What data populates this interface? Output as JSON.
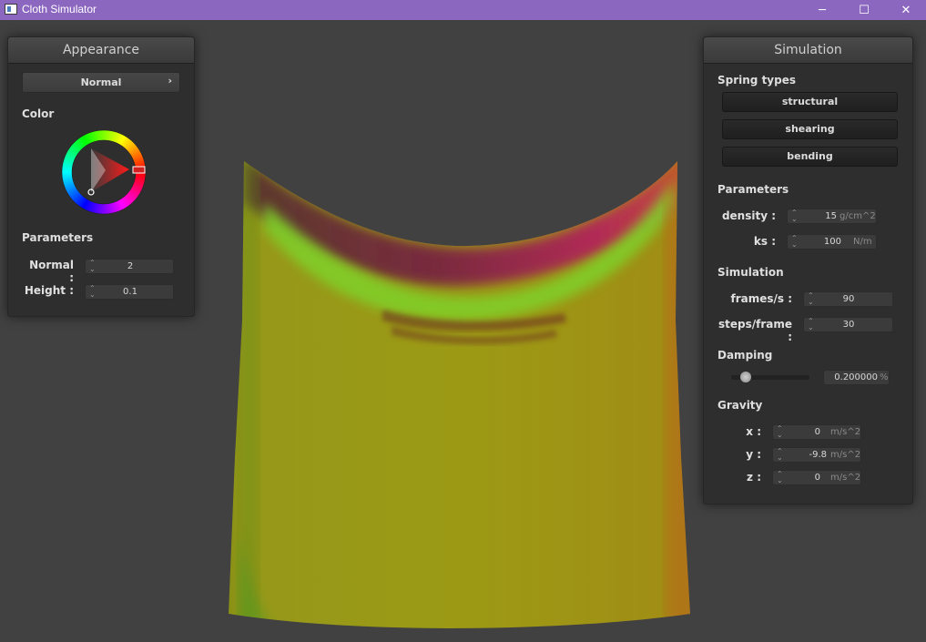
{
  "window": {
    "title": "Cloth Simulator",
    "minimize_glyph": "─",
    "maximize_glyph": "☐",
    "close_glyph": "✕"
  },
  "appearance": {
    "title": "Appearance",
    "shader_dropdown": {
      "selected": "Normal",
      "chevron": "›"
    },
    "color_label": "Color",
    "parameters_label": "Parameters",
    "params": [
      {
        "label": "Normal :",
        "value": "2"
      },
      {
        "label": "Height :",
        "value": "0.1"
      }
    ]
  },
  "simulation": {
    "title": "Simulation",
    "spring_types_label": "Spring types",
    "spring_buttons": [
      "structural",
      "shearing",
      "bending"
    ],
    "parameters_label": "Parameters",
    "density": {
      "label": "density :",
      "value": "15",
      "unit": "g/cm^2"
    },
    "ks": {
      "label": "ks :",
      "value": "100",
      "unit": "N/m"
    },
    "simulation_label": "Simulation",
    "frames": {
      "label": "frames/s :",
      "value": "90"
    },
    "steps": {
      "label": "steps/frame :",
      "value": "30"
    },
    "damping_label": "Damping",
    "damping": {
      "value": "0.200000",
      "unit": "%",
      "slider_fraction": 0.2
    },
    "gravity_label": "Gravity",
    "gravity": [
      {
        "label": "x :",
        "value": "0",
        "unit": "m/s^2"
      },
      {
        "label": "y :",
        "value": "-9.8",
        "unit": "m/s^2"
      },
      {
        "label": "z :",
        "value": "0",
        "unit": "m/s^2"
      }
    ]
  },
  "colors": {
    "titlebar": "#8c67c0",
    "background": "#414141",
    "cloth_base": "#9a9b12"
  }
}
